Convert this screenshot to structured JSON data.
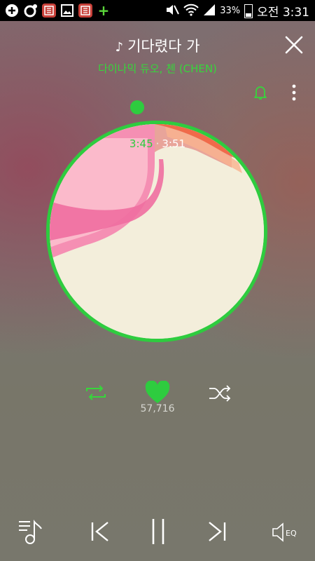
{
  "status_bar": {
    "battery": "33%",
    "clock": "오전 3:31"
  },
  "song": {
    "title": "기다렸다 가",
    "artist": "다이나믹 듀오, 첸 (CHEN)"
  },
  "player": {
    "current_time": "3:45",
    "separator": "·",
    "total_time": "3:51",
    "progress_fraction": 0.974,
    "like_count": "57,716"
  },
  "colors": {
    "accent": "#2ecc3f"
  },
  "icons": [
    "status-add-icon",
    "status-circle-icon",
    "status-app-icon",
    "status-gallery-icon",
    "status-app2-icon",
    "status-plus-icon",
    "mute-icon",
    "wifi-icon",
    "signal-icon",
    "battery-icon",
    "music-note-icon",
    "close-icon",
    "bell-icon",
    "more-vertical-icon",
    "repeat-icon",
    "heart-icon",
    "shuffle-icon",
    "playlist-icon",
    "previous-icon",
    "pause-icon",
    "next-icon",
    "eq-icon"
  ]
}
